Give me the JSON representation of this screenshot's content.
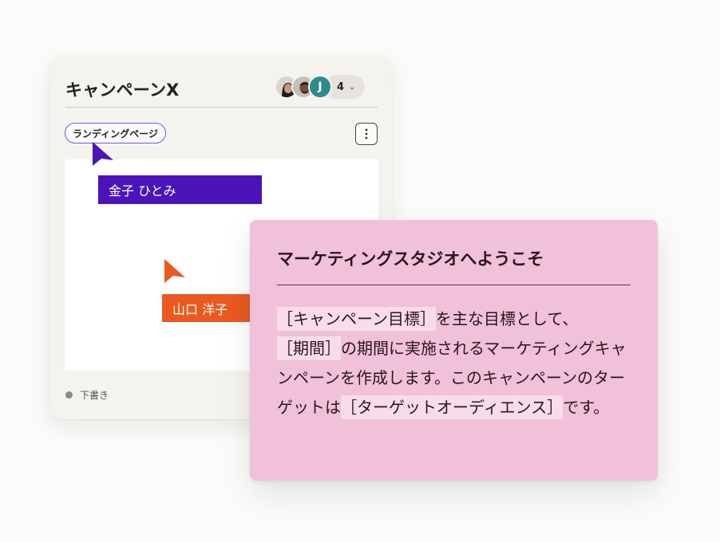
{
  "campaign_card": {
    "title": "キャンペーンX",
    "collaborators": {
      "initial": "J",
      "count": "4",
      "avatar_icons": [
        "user-avatar-woman",
        "user-avatar-man",
        "user-avatar-initial"
      ]
    },
    "tag": "ランディングページ",
    "status": "下書き",
    "status_color": "#8a8a8a"
  },
  "cursors": [
    {
      "name": "金子 ひとみ",
      "color": "#4b14b8"
    },
    {
      "name": "山口 洋子",
      "color": "#ea5a20"
    }
  ],
  "welcome_panel": {
    "title": "マーケティングスタジオへようこそ",
    "body": {
      "placeholder_goal": "［キャンペーン目標］",
      "text_1": "を主な目標として、",
      "placeholder_period": "［期間］",
      "text_2": "の期間に実施されるマーケティングキャンペーンを作成します。このキャンペーンのターゲットは",
      "placeholder_audience": "［ターゲットオーディエンス］",
      "text_3": "です。"
    },
    "background_color": "#f0c1d9"
  }
}
